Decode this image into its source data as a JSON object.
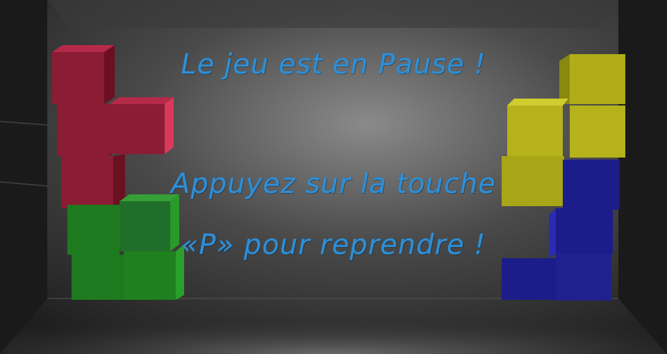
{
  "pause_message": {
    "title": "Le jeu est en Pause !",
    "instruction_line1": "Appuyez sur la touche",
    "instruction_line2": "«P» pour reprendre !"
  },
  "colors": {
    "text": "#2f8fd6",
    "red_block": "#8a1c34",
    "green_block": "#1e7a1e",
    "yellow_block": "#b5b21c",
    "blue_block": "#1c1c8a",
    "background": "#2a2a2a"
  }
}
